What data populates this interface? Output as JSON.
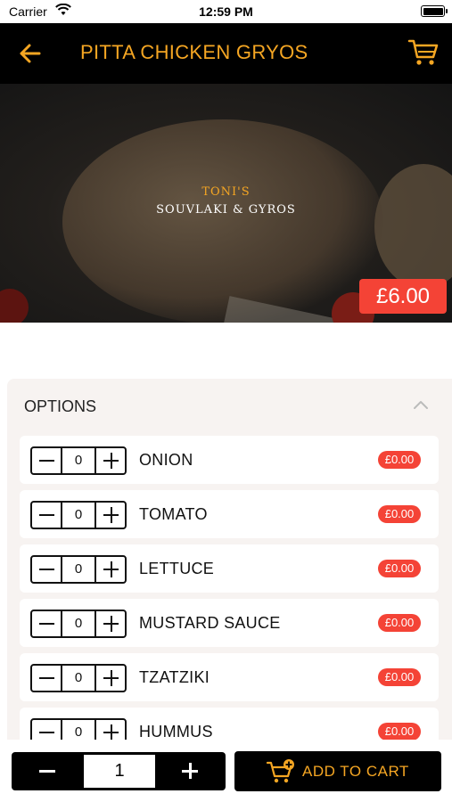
{
  "status_bar": {
    "carrier": "Carrier",
    "time": "12:59 PM"
  },
  "nav": {
    "title": "PITTA CHICKEN GRYOS"
  },
  "hero": {
    "logo_line1": "TONI'S",
    "logo_line2": "SOUVLAKI & GYROS",
    "price": "£6.00"
  },
  "options": {
    "header": "OPTIONS",
    "items": [
      {
        "name": "ONION",
        "qty": "0",
        "price": "£0.00"
      },
      {
        "name": "TOMATO",
        "qty": "0",
        "price": "£0.00"
      },
      {
        "name": "LETTUCE",
        "qty": "0",
        "price": "£0.00"
      },
      {
        "name": "MUSTARD SAUCE",
        "qty": "0",
        "price": "£0.00"
      },
      {
        "name": "TZATZIKI",
        "qty": "0",
        "price": "£0.00"
      },
      {
        "name": "HUMMUS",
        "qty": "0",
        "price": "£0.00"
      }
    ]
  },
  "bottom": {
    "quantity": "1",
    "add_to_cart_label": "ADD TO CART"
  },
  "colors": {
    "accent": "#f5a623",
    "price_red": "#f44336",
    "bar_black": "#000000"
  }
}
